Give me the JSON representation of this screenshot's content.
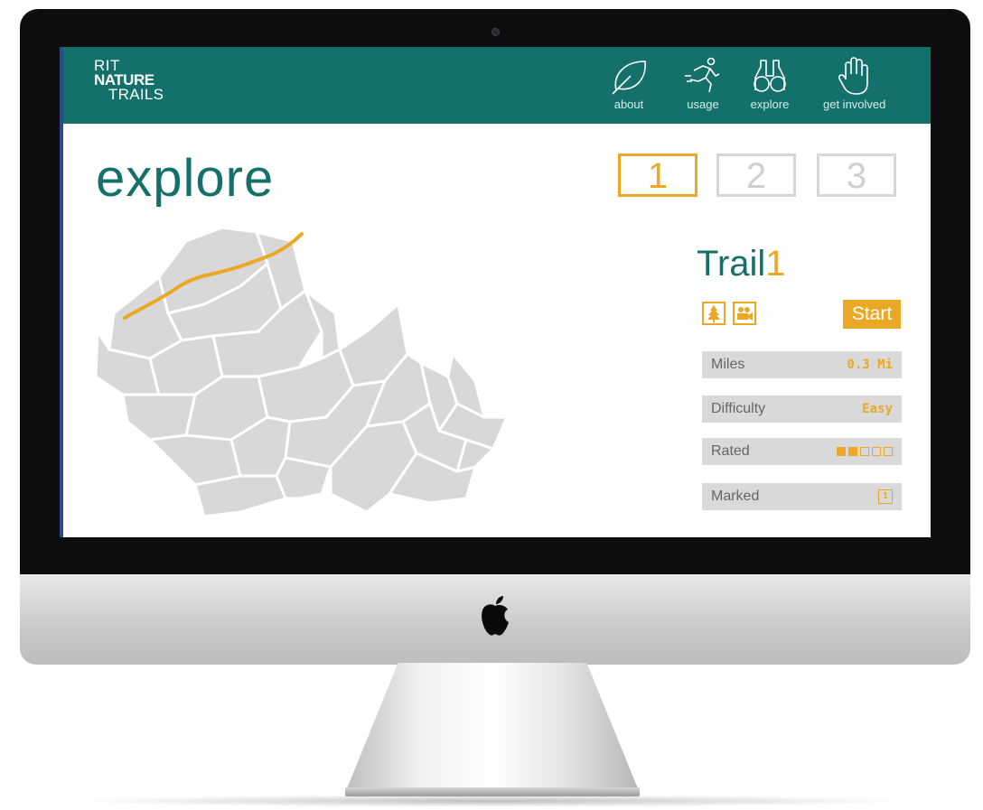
{
  "brand": {
    "line1": "RIT",
    "line2": "NATURE",
    "line3": "TRAILS"
  },
  "nav": [
    {
      "label": "about",
      "icon": "leaf-icon"
    },
    {
      "label": "usage",
      "icon": "runner-icon"
    },
    {
      "label": "explore",
      "icon": "binoculars-icon"
    },
    {
      "label": "get involved",
      "icon": "hand-icon"
    }
  ],
  "page": {
    "title": "explore"
  },
  "steps": [
    {
      "label": "1",
      "active": true
    },
    {
      "label": "2",
      "active": false
    },
    {
      "label": "3",
      "active": false
    }
  ],
  "trail": {
    "title_prefix": "Trail",
    "number": "1",
    "features": [
      "tree-icon",
      "camera-icon"
    ],
    "start_label": "Start",
    "stats": {
      "miles": {
        "label": "Miles",
        "value": "0.3 Mi"
      },
      "difficulty": {
        "label": "Difficulty",
        "value": "Easy"
      },
      "rated": {
        "label": "Rated",
        "rating": 2,
        "max": 5
      },
      "marked": {
        "label": "Marked",
        "value": "1"
      }
    }
  },
  "colors": {
    "teal": "#13706a",
    "accent": "#eaa824",
    "map_fill": "#d8d8d8",
    "panel": "#d9d9d9"
  }
}
